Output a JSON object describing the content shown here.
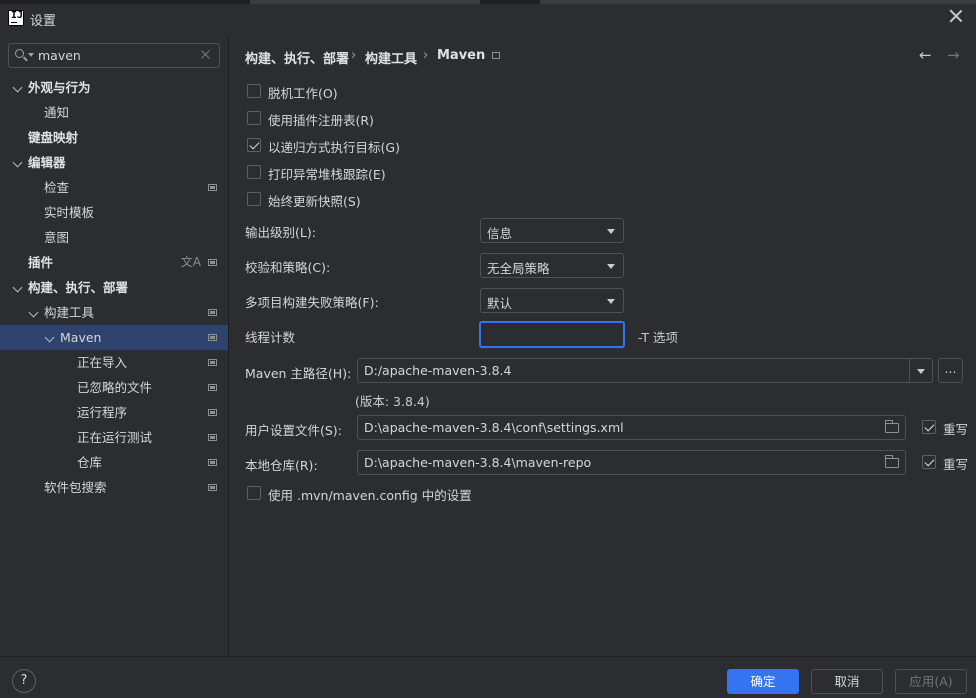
{
  "window": {
    "title": "设置",
    "app_icon_text": "IJ"
  },
  "search": {
    "value": "maven"
  },
  "tree": [
    {
      "label": "外观与行为",
      "level": 0,
      "expanded": true,
      "bold": true,
      "badge": false
    },
    {
      "label": "通知",
      "level": 1,
      "expanded": null,
      "bold": false,
      "badge": false
    },
    {
      "label": "键盘映射",
      "level": 0,
      "expanded": null,
      "bold": true,
      "badge": false
    },
    {
      "label": "编辑器",
      "level": 0,
      "expanded": true,
      "bold": true,
      "badge": false
    },
    {
      "label": "检查",
      "level": 1,
      "expanded": null,
      "bold": false,
      "badge": true
    },
    {
      "label": "实时模板",
      "level": 1,
      "expanded": null,
      "bold": false,
      "badge": false
    },
    {
      "label": "意图",
      "level": 1,
      "expanded": null,
      "bold": false,
      "badge": false
    },
    {
      "label": "插件",
      "level": 0,
      "expanded": null,
      "bold": true,
      "badge": true,
      "translate_icon": "文A"
    },
    {
      "label": "构建、执行、部署",
      "level": 0,
      "expanded": true,
      "bold": true,
      "badge": false
    },
    {
      "label": "构建工具",
      "level": 1,
      "expanded": true,
      "bold": false,
      "badge": true
    },
    {
      "label": "Maven",
      "level": 2,
      "expanded": true,
      "bold": false,
      "badge": true,
      "selected": true
    },
    {
      "label": "正在导入",
      "level": 3,
      "expanded": null,
      "bold": false,
      "badge": true
    },
    {
      "label": "已忽略的文件",
      "level": 3,
      "expanded": null,
      "bold": false,
      "badge": true
    },
    {
      "label": "运行程序",
      "level": 3,
      "expanded": null,
      "bold": false,
      "badge": true
    },
    {
      "label": "正在运行测试",
      "level": 3,
      "expanded": null,
      "bold": false,
      "badge": true
    },
    {
      "label": "仓库",
      "level": 3,
      "expanded": null,
      "bold": false,
      "badge": true
    },
    {
      "label": "软件包搜索",
      "level": 1,
      "expanded": null,
      "bold": false,
      "badge": true
    }
  ],
  "breadcrumb": {
    "items": [
      "构建、执行、部署",
      "构建工具",
      "Maven"
    ],
    "separator": "›"
  },
  "nav": {
    "back": "←",
    "forward": "→"
  },
  "options": [
    {
      "label": "脱机工作(O)",
      "checked": false
    },
    {
      "label": "使用插件注册表(R)",
      "checked": false
    },
    {
      "label": "以递归方式执行目标(G)",
      "checked": true
    },
    {
      "label": "打印异常堆栈跟踪(E)",
      "checked": false
    },
    {
      "label": "始终更新快照(S)",
      "checked": false
    }
  ],
  "fields": {
    "output_level": {
      "label": "输出级别(L):",
      "value": "信息"
    },
    "checksum_policy": {
      "label": "校验和策略(C):",
      "value": "无全局策略"
    },
    "multiproject_fail": {
      "label": "多项目构建失败策略(F):",
      "value": "默认"
    },
    "thread_count": {
      "label": "线程计数",
      "value": "",
      "hint": "-T 选项"
    },
    "maven_home": {
      "label": "Maven 主路径(H):",
      "value": "D:/apache-maven-3.8.4",
      "version": "(版本: 3.8.4)",
      "browse": "..."
    },
    "user_settings": {
      "label": "用户设置文件(S):",
      "value": "D:\\apache-maven-3.8.4\\conf\\settings.xml",
      "override_label": "重写",
      "override": true
    },
    "local_repo": {
      "label": "本地仓库(R):",
      "value": "D:\\apache-maven-3.8.4\\maven-repo",
      "override_label": "重写",
      "override": true
    }
  },
  "mvn_config": {
    "label": "使用 .mvn/maven.config 中的设置",
    "checked": false
  },
  "footer": {
    "help": "?",
    "ok": "确定",
    "cancel": "取消",
    "apply": "应用(A)"
  },
  "colors": {
    "background": "#2b2d30",
    "selection": "#2e436e",
    "accent": "#3574f0"
  }
}
